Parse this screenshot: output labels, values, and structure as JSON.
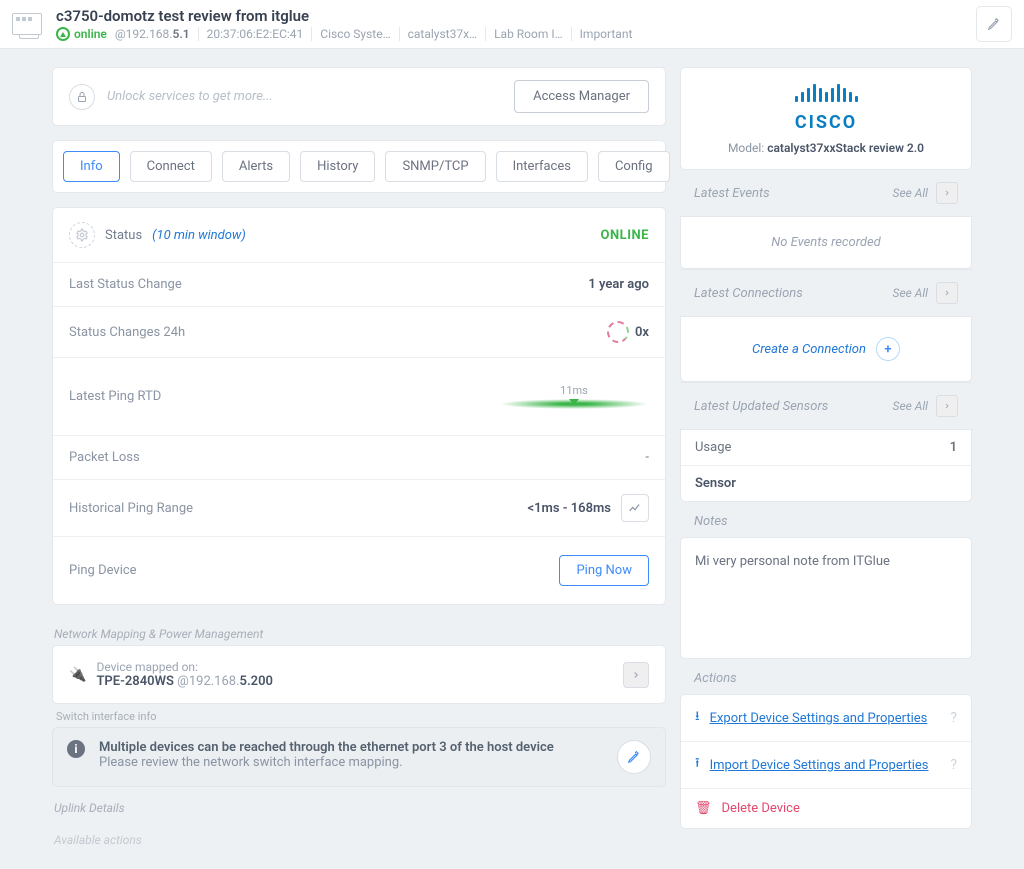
{
  "header": {
    "title": "c3750-domotz test review from itglue",
    "status": "online",
    "ip_prefix": "@192.168.",
    "ip_bold": "5.1",
    "mac": "20:37:06:E2:EC:41",
    "vendor": "Cisco Syste…",
    "model": "catalyst37x…",
    "location": "Lab Room I…",
    "priority": "Important"
  },
  "unlock": {
    "placeholder": "Unlock services to get more...",
    "button": "Access Manager"
  },
  "tabs": [
    "Info",
    "Connect",
    "Alerts",
    "History",
    "SNMP/TCP",
    "Interfaces",
    "Config"
  ],
  "status_card": {
    "label": "Status",
    "window": "(10 min window)",
    "value": "ONLINE",
    "last_change_label": "Last Status Change",
    "last_change_value": "1 year ago",
    "changes_24h_label": "Status Changes 24h",
    "changes_24h_value": "0x",
    "ping_label": "Latest Ping RTD",
    "ping_value": "11ms",
    "packet_loss_label": "Packet Loss",
    "packet_loss_value": "-",
    "hist_label": "Historical Ping Range",
    "hist_value": "<1ms - 168ms",
    "ping_device_label": "Ping Device",
    "ping_now": "Ping Now"
  },
  "mapping": {
    "section_title": "Network Mapping & Power Management",
    "mapped_on_label": "Device mapped on:",
    "mapped_dev": "TPE-2840WS",
    "mapped_ip_prefix": " @192.168.",
    "mapped_ip_bold": "5.200",
    "switch_label": "Switch interface info",
    "banner_title": "Multiple devices can be reached through the ethernet port 3 of the host device",
    "banner_sub": "Please review the network switch interface mapping.",
    "uplink_title": "Uplink Details",
    "available_actions": "Available actions"
  },
  "sidebar": {
    "model_label": "Model: ",
    "model_value": "catalyst37xxStack review 2.0",
    "events_title": "Latest Events",
    "see_all": "See All",
    "events_empty": "No Events recorded",
    "connections_title": "Latest Connections",
    "create_connection": "Create a Connection",
    "sensors_title": "Latest Updated Sensors",
    "sensors_usage_label": "Usage",
    "sensors_usage_count": "1",
    "sensor_name": "Sensor",
    "notes_title": "Notes",
    "notes_body": "Mi very personal note from ITGlue",
    "actions_title": "Actions",
    "action_export": "Export Device Settings and Properties",
    "action_import": "Import Device Settings and Properties",
    "action_delete": "Delete Device"
  }
}
